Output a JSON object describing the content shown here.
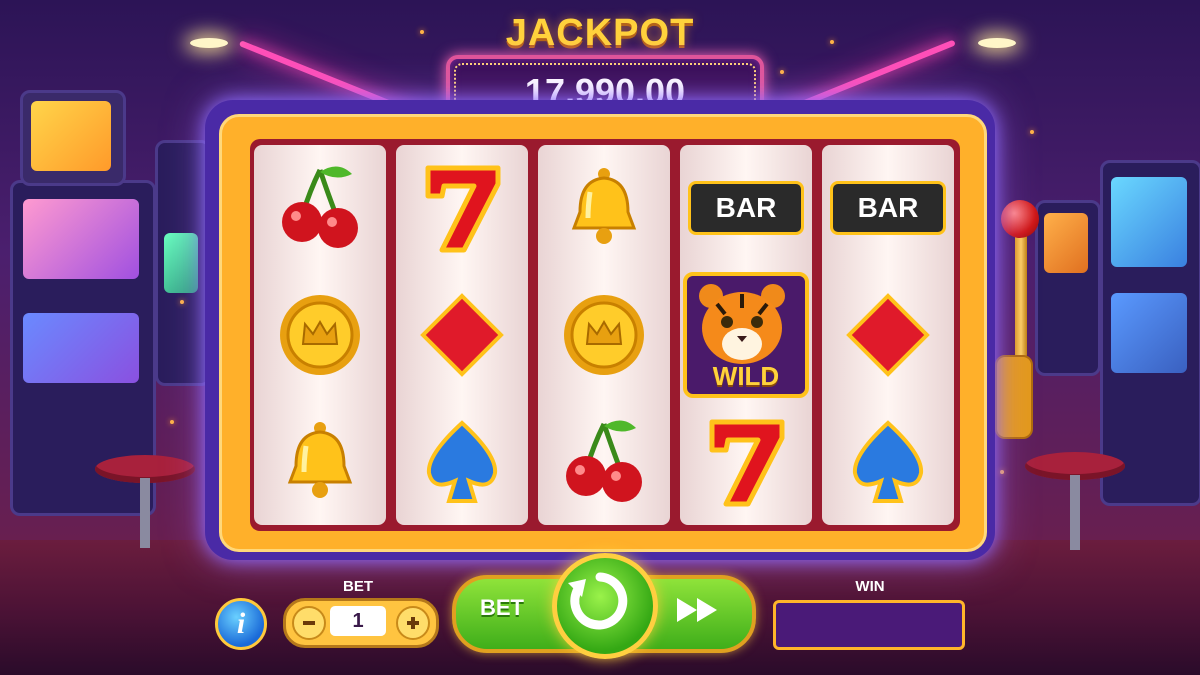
{
  "jackpot": {
    "title": "JACKPOT",
    "amount": "17,990.00"
  },
  "reels": [
    {
      "symbols": [
        "cherry",
        "coin",
        "bell"
      ]
    },
    {
      "symbols": [
        "seven",
        "diamond",
        "spade"
      ]
    },
    {
      "symbols": [
        "bell",
        "coin",
        "cherry"
      ]
    },
    {
      "symbols": [
        "bar",
        "tiger-wild",
        "seven"
      ]
    },
    {
      "symbols": [
        "bar",
        "diamond",
        "spade"
      ]
    }
  ],
  "symbol_text": {
    "bar": "BAR",
    "wild": "WILD"
  },
  "controls": {
    "info_label": "i",
    "bet_caption": "BET",
    "bet_value": "1",
    "bet_button_label": "BET",
    "win_caption": "WIN",
    "win_value": ""
  },
  "colors": {
    "jackpot_gold": "#ffd23c",
    "cabinet_frame": "#ffb02a",
    "spin_green": "#3fae1a",
    "neon_pink": "#ff4fb8"
  },
  "icons": [
    "info-icon",
    "minus-icon",
    "plus-icon",
    "spin-icon",
    "fast-forward-icon",
    "lever"
  ]
}
